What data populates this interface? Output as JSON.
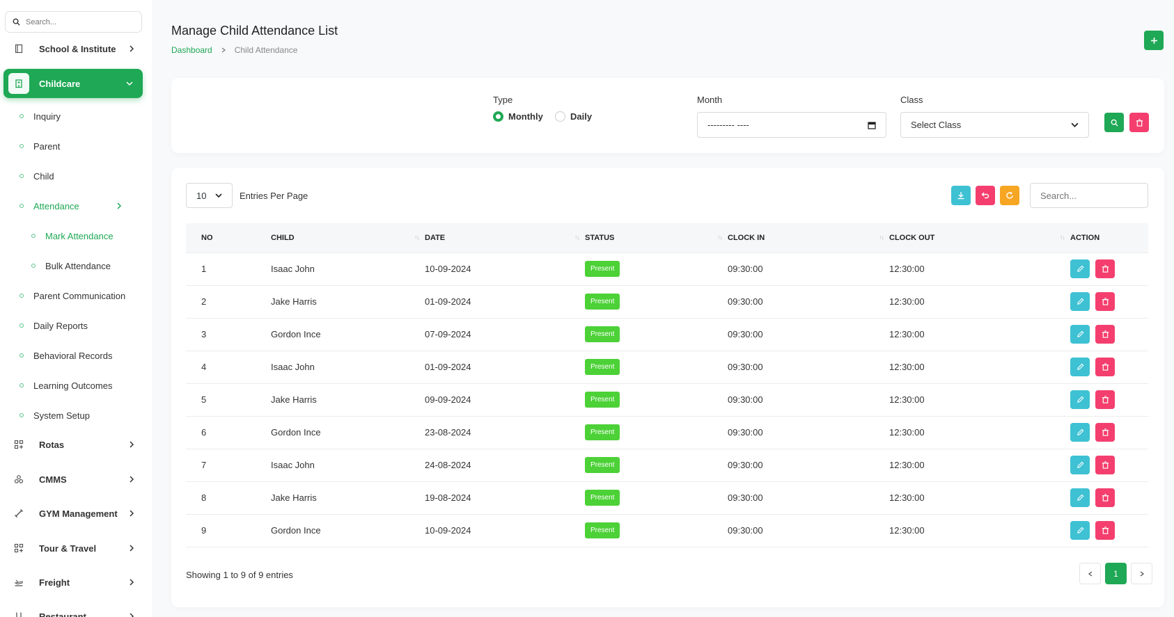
{
  "sidebar": {
    "search_placeholder": "Search...",
    "top_items": [
      {
        "label": "School & Institute"
      },
      {
        "label": "Childcare"
      }
    ],
    "childcare_items": [
      {
        "label": "Inquiry"
      },
      {
        "label": "Parent"
      },
      {
        "label": "Child"
      },
      {
        "label": "Attendance"
      }
    ],
    "attendance_items": [
      {
        "label": "Mark Attendance"
      },
      {
        "label": "Bulk Attendance"
      }
    ],
    "more_childcare_items": [
      {
        "label": "Parent Communication"
      },
      {
        "label": "Daily Reports"
      },
      {
        "label": "Behavioral Records"
      },
      {
        "label": "Learning Outcomes"
      },
      {
        "label": "System Setup"
      }
    ],
    "bottom_items": [
      {
        "label": "Rotas"
      },
      {
        "label": "CMMS"
      },
      {
        "label": "GYM Management"
      },
      {
        "label": "Tour & Travel"
      },
      {
        "label": "Freight"
      },
      {
        "label": "Restaurant"
      }
    ]
  },
  "header": {
    "title": "Manage Child Attendance List",
    "breadcrumb_home": "Dashboard",
    "breadcrumb_current": "Child Attendance"
  },
  "filter": {
    "type_label": "Type",
    "type_monthly": "Monthly",
    "type_daily": "Daily",
    "month_label": "Month",
    "month_value": "--------- ----",
    "class_label": "Class",
    "class_value": "Select Class"
  },
  "table": {
    "entries_value": "10",
    "entries_label": "Entries Per Page",
    "search_placeholder": "Search...",
    "headers": {
      "no": "NO",
      "child": "CHILD",
      "date": "DATE",
      "status": "STATUS",
      "clock_in": "CLOCK IN",
      "clock_out": "CLOCK OUT",
      "action": "ACTION"
    },
    "rows": [
      {
        "no": "1",
        "child": "Isaac John",
        "date": "10-09-2024",
        "status": "Present",
        "clock_in": "09:30:00",
        "clock_out": "12:30:00"
      },
      {
        "no": "2",
        "child": "Jake Harris",
        "date": "01-09-2024",
        "status": "Present",
        "clock_in": "09:30:00",
        "clock_out": "12:30:00"
      },
      {
        "no": "3",
        "child": "Gordon Ince",
        "date": "07-09-2024",
        "status": "Present",
        "clock_in": "09:30:00",
        "clock_out": "12:30:00"
      },
      {
        "no": "4",
        "child": "Isaac John",
        "date": "01-09-2024",
        "status": "Present",
        "clock_in": "09:30:00",
        "clock_out": "12:30:00"
      },
      {
        "no": "5",
        "child": "Jake Harris",
        "date": "09-09-2024",
        "status": "Present",
        "clock_in": "09:30:00",
        "clock_out": "12:30:00"
      },
      {
        "no": "6",
        "child": "Gordon Ince",
        "date": "23-08-2024",
        "status": "Present",
        "clock_in": "09:30:00",
        "clock_out": "12:30:00"
      },
      {
        "no": "7",
        "child": "Isaac John",
        "date": "24-08-2024",
        "status": "Present",
        "clock_in": "09:30:00",
        "clock_out": "12:30:00"
      },
      {
        "no": "8",
        "child": "Jake Harris",
        "date": "19-08-2024",
        "status": "Present",
        "clock_in": "09:30:00",
        "clock_out": "12:30:00"
      },
      {
        "no": "9",
        "child": "Gordon Ince",
        "date": "10-09-2024",
        "status": "Present",
        "clock_in": "09:30:00",
        "clock_out": "12:30:00"
      }
    ],
    "showing": "Showing 1 to 9 of 9 entries",
    "current_page": "1"
  },
  "colors": {
    "accent": "#1fa855",
    "info": "#3ec1d3",
    "danger": "#f43f6e",
    "warning": "#f6a623",
    "present": "#4cd137"
  }
}
